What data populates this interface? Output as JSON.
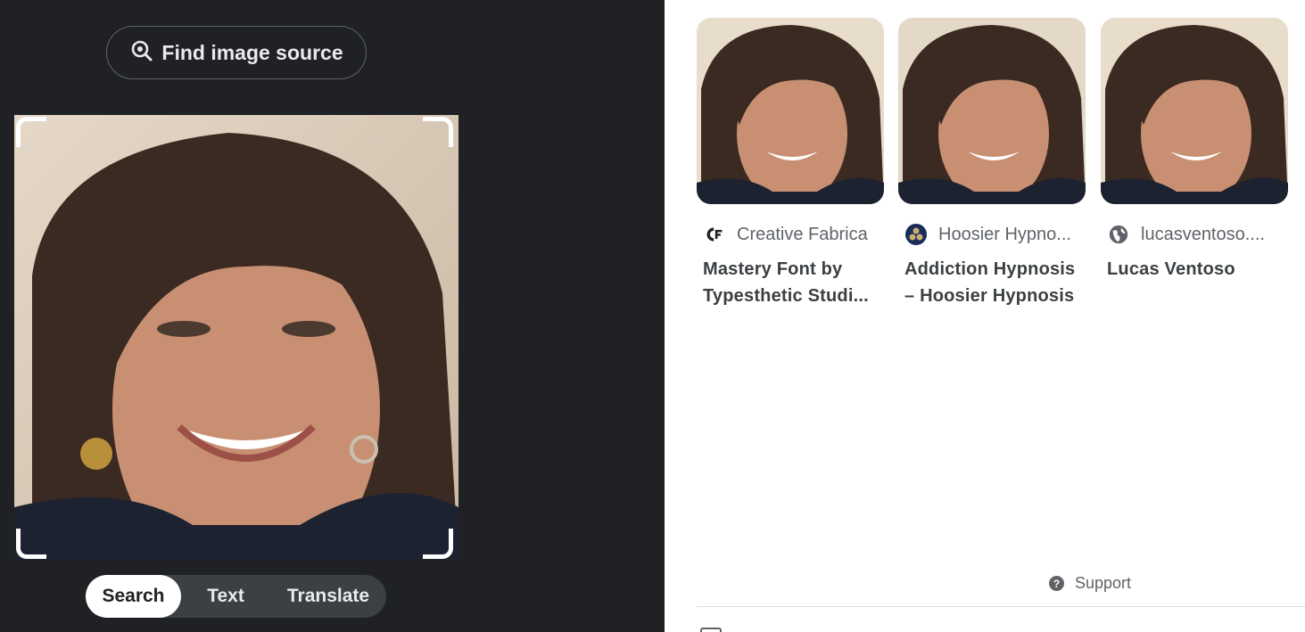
{
  "left": {
    "find_source_label": "Find image source",
    "find_source_icon": "lens-search-icon",
    "tabs": [
      {
        "label": "Search",
        "active": true
      },
      {
        "label": "Text",
        "active": false
      },
      {
        "label": "Translate",
        "active": false
      }
    ]
  },
  "results": [
    {
      "source": "Creative Fabrica",
      "source_icon": "creative-fabrica-logo-icon",
      "title": "Mastery Font by Typesthetic Studi..."
    },
    {
      "source": "Hoosier Hypno...",
      "source_icon": "hoosier-hypnosis-logo-icon",
      "title": "Addiction Hypnosis – Hoosier Hypnosis"
    },
    {
      "source": "lucasventoso....",
      "source_icon": "globe-icon",
      "title": "Lucas Ventoso"
    }
  ],
  "footer": {
    "support_label": "Support",
    "support_icon": "help-circle-icon"
  },
  "colors": {
    "dark_panel": "#202124",
    "tab_bg": "#3c4043",
    "text_light": "#e8eaed",
    "text_muted": "#5f6368"
  }
}
